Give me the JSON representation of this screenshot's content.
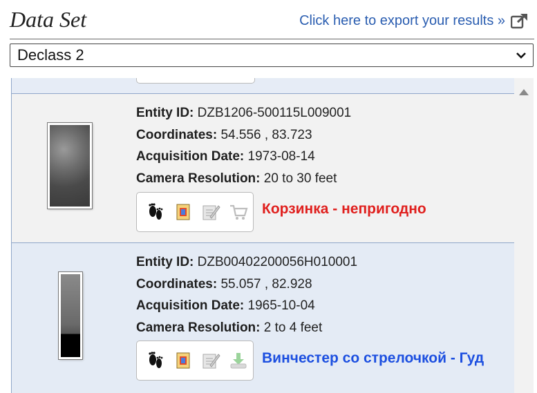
{
  "header": {
    "title": "Data Set",
    "export_label": "Click here to export your results »",
    "export_icon": "external-link-icon"
  },
  "dataset_select": {
    "selected": "Declass 2"
  },
  "labels": {
    "entity_id": "Entity ID:",
    "coordinates": "Coordinates:",
    "acquisition_date": "Acquisition Date:",
    "camera_resolution": "Camera Resolution:"
  },
  "results": [
    {
      "entity_id": "DZB1206-500115L009001",
      "coordinates": "54.556 , 83.723",
      "acquisition_date": "1973-08-14",
      "camera_resolution": "20 to 30 feet",
      "tools": [
        "footprint-icon",
        "metadata-icon",
        "compare-icon",
        "cart-icon"
      ],
      "note": "Корзинка - непригодно",
      "note_color": "#e0201e"
    },
    {
      "entity_id": "DZB00402200056H010001",
      "coordinates": "55.057 , 82.928",
      "acquisition_date": "1965-10-04",
      "camera_resolution": "2 to 4 feet",
      "tools": [
        "footprint-icon",
        "metadata-icon",
        "compare-icon",
        "download-icon"
      ],
      "note": "Винчестер со стрелочкой - Гуд",
      "note_color": "#1c4fe0"
    }
  ],
  "colors": {
    "link": "#2a5db0",
    "row_alt": "#e4ebf5",
    "row": "#f2f2f2",
    "border": "#8fa6c9"
  }
}
